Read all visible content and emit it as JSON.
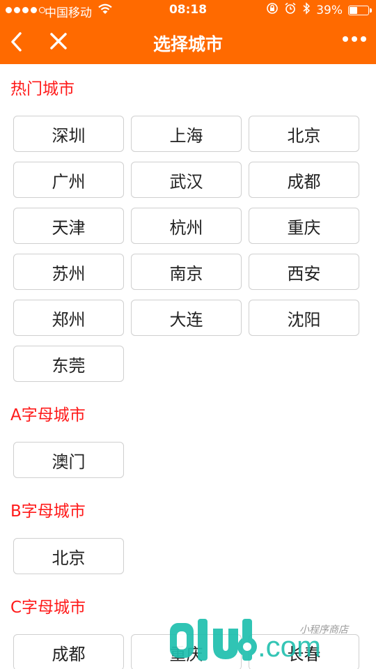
{
  "status_bar": {
    "carrier": "中国移动",
    "time": "08:18",
    "battery_percent_text": "39%",
    "battery_level": 0.39
  },
  "nav": {
    "title": "选择城市"
  },
  "sections": [
    {
      "title": "热门城市",
      "cities": [
        "深圳",
        "上海",
        "北京",
        "广州",
        "武汉",
        "成都",
        "天津",
        "杭州",
        "重庆",
        "苏州",
        "南京",
        "西安",
        "郑州",
        "大连",
        "沈阳",
        "东莞"
      ]
    },
    {
      "title": "A字母城市",
      "cities": [
        "澳门"
      ]
    },
    {
      "title": "B字母城市",
      "cities": [
        "北京"
      ]
    },
    {
      "title": "C字母城市",
      "cities": [
        "成都",
        "重庆",
        "长春"
      ]
    }
  ],
  "watermark": {
    "logo_text": "51ud.com",
    "tagline": "小程序商店"
  },
  "colors": {
    "header": "#ff6a00",
    "section_title": "#ff1a1a",
    "watermark_teal": "#1fbfae"
  }
}
